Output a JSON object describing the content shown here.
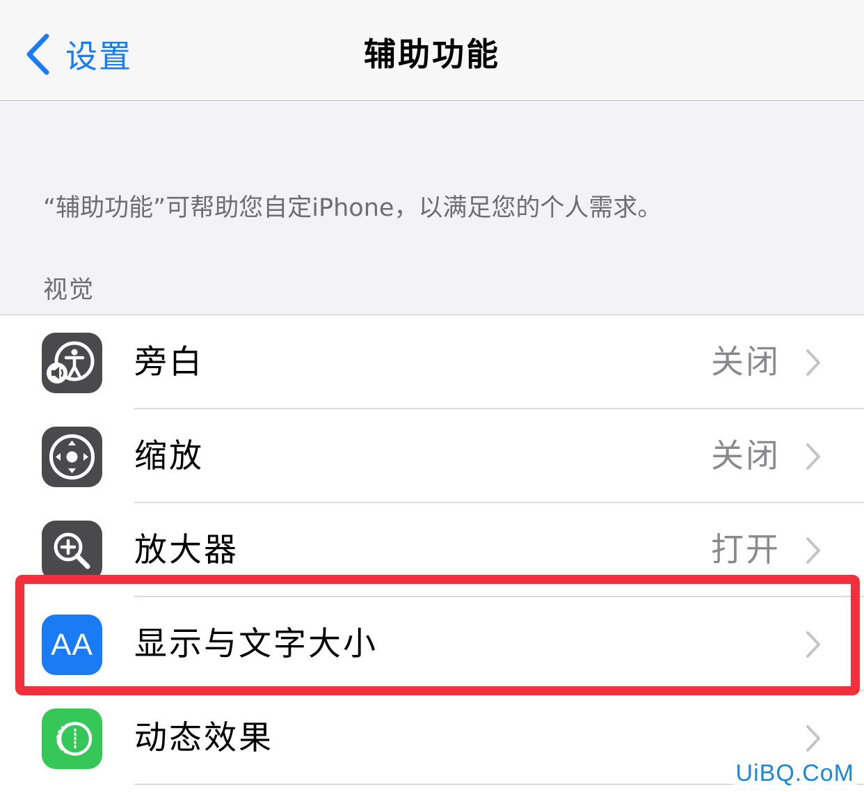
{
  "navbar": {
    "back_label": "设置",
    "title": "辅助功能"
  },
  "description": "“辅助功能”可帮助您自定iPhone，以满足您的个人需求。",
  "section_header": "视觉",
  "items": [
    {
      "label": "旁白",
      "value": "关闭",
      "icon": "voiceover-icon"
    },
    {
      "label": "缩放",
      "value": "关闭",
      "icon": "zoom-icon"
    },
    {
      "label": "放大器",
      "value": "打开",
      "icon": "magnifier-icon"
    },
    {
      "label": "显示与文字大小",
      "value": "",
      "icon": "display-text-size-icon",
      "icon_text": "AA"
    },
    {
      "label": "动态效果",
      "value": "",
      "icon": "motion-icon"
    }
  ],
  "highlight": {
    "target": "显示与文字大小",
    "color": "#f0303a"
  },
  "watermark": "UiBQ.CoM",
  "colors": {
    "accent": "#1a7cf5",
    "icon_gray": "#4a4a4d",
    "icon_blue": "#1a7cf5",
    "icon_green": "#36c759",
    "highlight": "#f0303a"
  }
}
